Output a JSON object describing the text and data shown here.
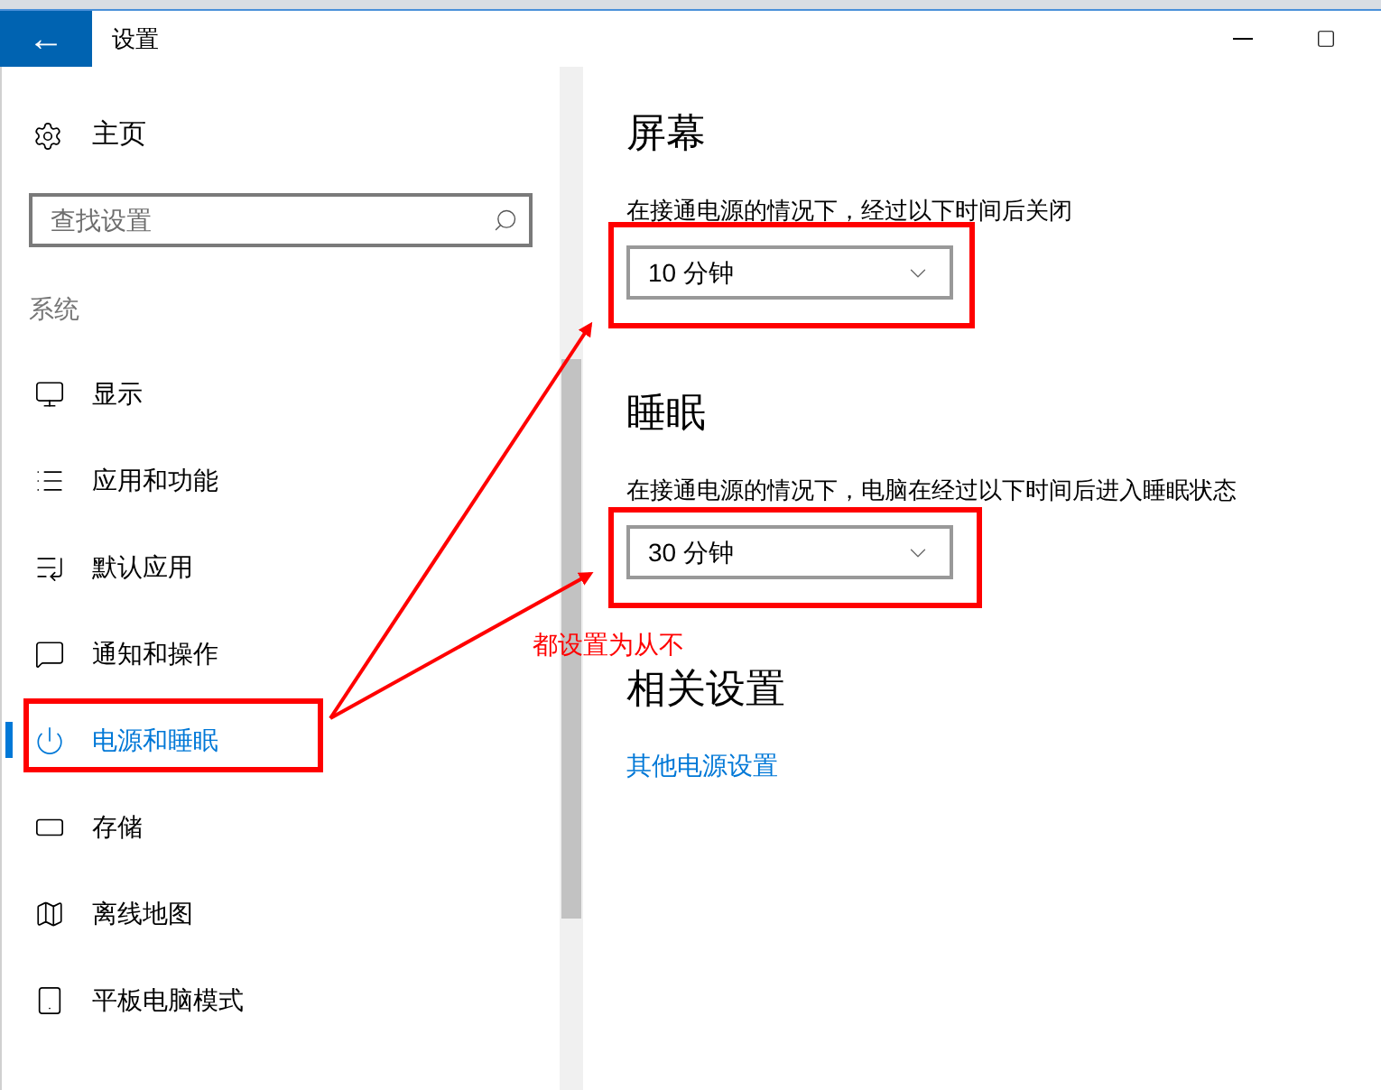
{
  "window": {
    "title": "设置",
    "back": "←"
  },
  "sidebar": {
    "home": "主页",
    "search": {
      "placeholder": "查找设置"
    },
    "section": "系统",
    "items": [
      {
        "label": "显示",
        "selected": false
      },
      {
        "label": "应用和功能",
        "selected": false
      },
      {
        "label": "默认应用",
        "selected": false
      },
      {
        "label": "通知和操作",
        "selected": false
      },
      {
        "label": "电源和睡眠",
        "selected": true
      },
      {
        "label": "存储",
        "selected": false
      },
      {
        "label": "离线地图",
        "selected": false
      },
      {
        "label": "平板电脑模式",
        "selected": false
      }
    ]
  },
  "sections": [
    {
      "heading": "屏幕",
      "description": "在接通电源的情况下，经过以下时间后关闭",
      "value": "10 分钟"
    },
    {
      "heading": "睡眠",
      "description": "在接通电源的情况下，电脑在经过以下时间后进入睡眠状态",
      "value": "30 分钟"
    }
  ],
  "related": {
    "heading": "相关设置",
    "link": "其他电源设置"
  },
  "annotation": {
    "note": "都设置为从不"
  }
}
